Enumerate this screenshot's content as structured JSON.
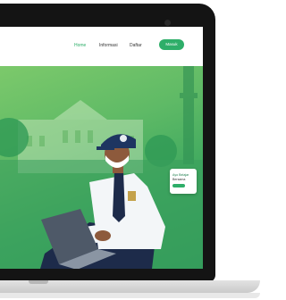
{
  "nav": {
    "links": [
      "Home",
      "Informasi",
      "Daftar"
    ],
    "button": "Masuk"
  },
  "hero_card": {
    "line1": "Ayo Belajar",
    "line2": "Bersama"
  },
  "colors": {
    "accent": "#2eae69",
    "bezel": "#141414",
    "hero_green": "#3ea85f"
  }
}
